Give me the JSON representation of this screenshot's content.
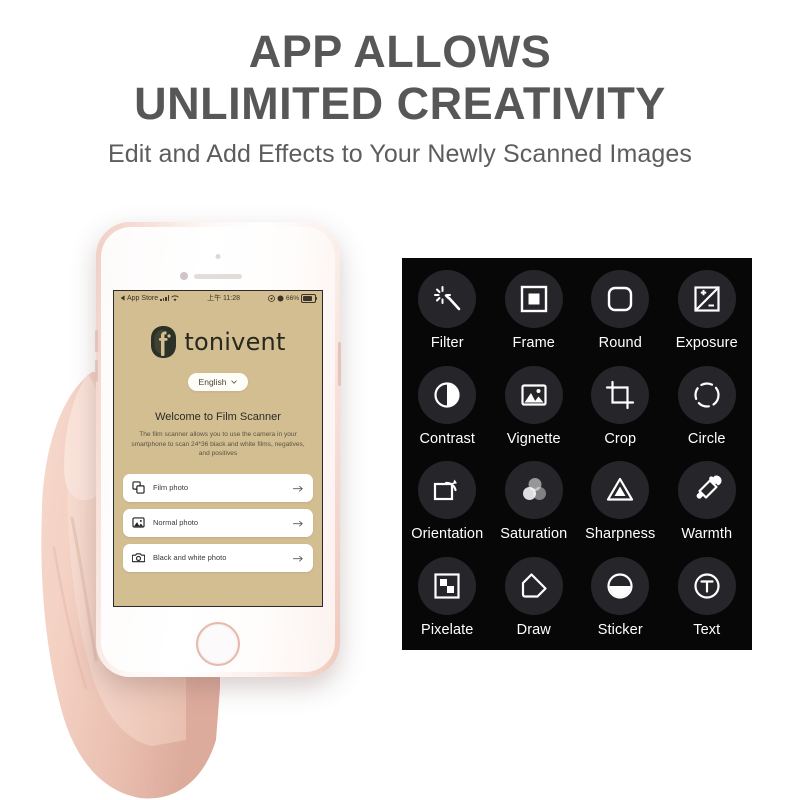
{
  "headline": {
    "line1": "APP ALLOWS",
    "line2": "UNLIMITED CREATIVITY",
    "subtitle": "Edit and Add Effects to Your Newly Scanned Images",
    "color": "#575757"
  },
  "phone": {
    "device": "rose-gold-iphone",
    "status_bar": {
      "app_label": "App Store",
      "time": "上午 11:28",
      "battery_text": "66%"
    },
    "app": {
      "brand_name": "tonivent",
      "language_label": "English",
      "welcome_title": "Welcome to Film Scanner",
      "description": "The film scanner allows you to use the camera in your smartphone to scan 24*36 black and white films, negatives, and positives",
      "background_color": "#D2BE90",
      "options": [
        {
          "label": "Film photo",
          "icon": "layers-icon"
        },
        {
          "label": "Normal photo",
          "icon": "image-icon"
        },
        {
          "label": "Black and white photo",
          "icon": "camera-icon"
        }
      ]
    }
  },
  "effects_panel": {
    "background_color": "#070707",
    "bubble_color": "#26262A",
    "label_color": "#FFFFFF",
    "items": [
      {
        "label": "Filter",
        "icon": "magic-wand-icon"
      },
      {
        "label": "Frame",
        "icon": "frame-square-icon"
      },
      {
        "label": "Round",
        "icon": "rounded-square-icon"
      },
      {
        "label": "Exposure",
        "icon": "exposure-icon"
      },
      {
        "label": "Contrast",
        "icon": "contrast-circle-icon"
      },
      {
        "label": "Vignette",
        "icon": "picture-icon"
      },
      {
        "label": "Crop",
        "icon": "crop-icon"
      },
      {
        "label": "Circle",
        "icon": "dashed-circle-icon"
      },
      {
        "label": "Orientation",
        "icon": "rotate-icon"
      },
      {
        "label": "Saturation",
        "icon": "three-circles-icon"
      },
      {
        "label": "Sharpness",
        "icon": "triangle-icon"
      },
      {
        "label": "Warmth",
        "icon": "eyedropper-icon"
      },
      {
        "label": "Pixelate",
        "icon": "pixelate-icon"
      },
      {
        "label": "Draw",
        "icon": "pen-icon"
      },
      {
        "label": "Sticker",
        "icon": "sticker-icon"
      },
      {
        "label": "Text",
        "icon": "text-circle-icon"
      }
    ]
  }
}
